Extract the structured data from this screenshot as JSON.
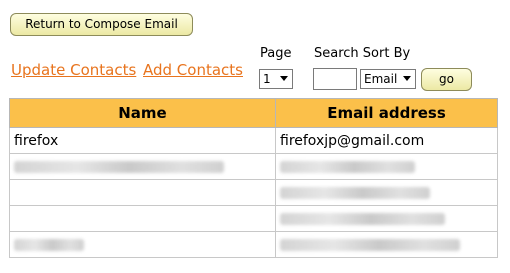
{
  "toolbar": {
    "return_label": "Return to Compose Email"
  },
  "links": {
    "update": "Update Contacts",
    "add": "Add Contacts"
  },
  "controls": {
    "page_label": "Page",
    "page_value": "1",
    "search_label": "Search Sort By",
    "search_value": "",
    "sort_value": "Email",
    "go_label": "go"
  },
  "table": {
    "headers": {
      "name": "Name",
      "email": "Email address"
    },
    "rows": [
      {
        "name": "firefox",
        "email": "firefoxjp@gmail.com"
      },
      {
        "name": "",
        "email": ""
      },
      {
        "name": "",
        "email": ""
      },
      {
        "name": "",
        "email": ""
      },
      {
        "name": "",
        "email": ""
      }
    ],
    "header_color": "#fbc04a"
  },
  "colors": {
    "link": "#e8741e",
    "button_bg": "#ece9a4"
  }
}
